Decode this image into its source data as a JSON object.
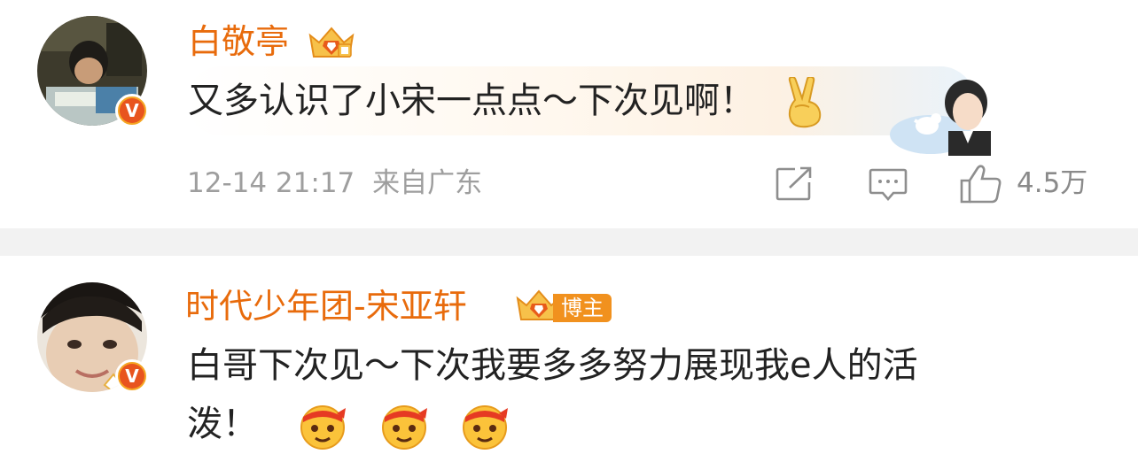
{
  "comments": [
    {
      "username": "白敬亭",
      "text": "又多认识了小宋一点点～下次见啊！",
      "emoji_name": "victory-hand",
      "timestamp": "12-14 21:17",
      "location": "来自广东",
      "likes": "4.5万"
    },
    {
      "username": "时代少年团-宋亚轩",
      "badge": "博主",
      "text_line1": "白哥下次见～下次我要多多努力展现我e人的活",
      "text_line2": "泼！",
      "emoji_name": "fighting-face"
    }
  ],
  "verified_mark": "V",
  "colors": {
    "username": "#e86b0c",
    "text": "#222222",
    "meta": "#9e9e9e",
    "divider": "#f2f2f2",
    "badge_orange": "#f5a623"
  }
}
